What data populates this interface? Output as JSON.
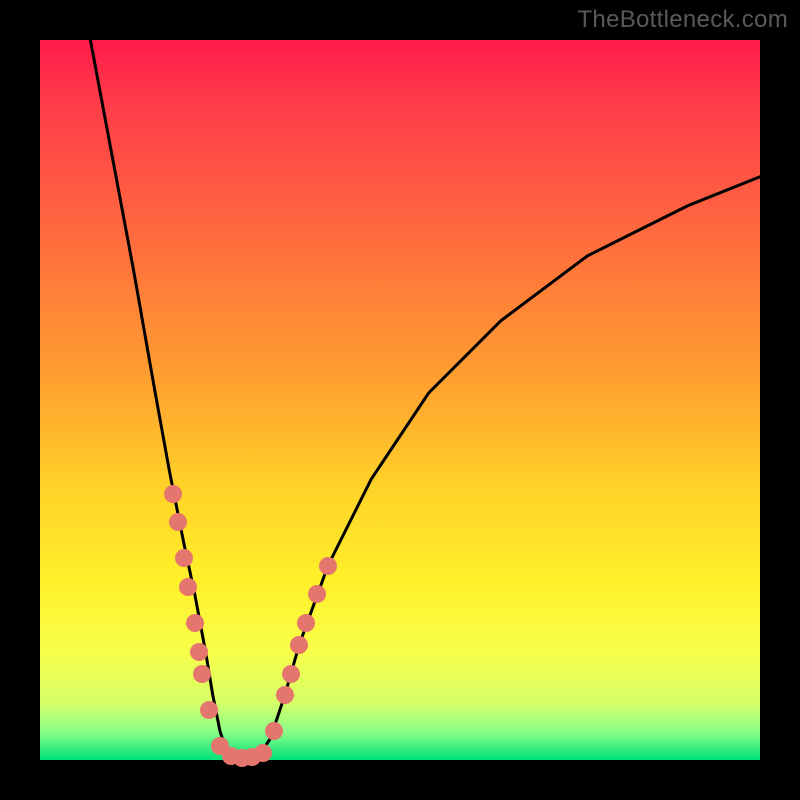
{
  "watermark": "TheBottleneck.com",
  "chart_data": {
    "type": "line",
    "title": "",
    "xlabel": "",
    "ylabel": "",
    "xlim": [
      0,
      100
    ],
    "ylim": [
      0,
      100
    ],
    "background_gradient": {
      "top": "#ff1a4a",
      "middle": "#fff02a",
      "bottom": "#00e27a"
    },
    "series": [
      {
        "name": "bottleneck-curve",
        "x": [
          7,
          10,
          13,
          16,
          18,
          20,
          21.5,
          23,
          24,
          25,
          26,
          27,
          30,
          32,
          34,
          36,
          40,
          46,
          54,
          64,
          76,
          90,
          100
        ],
        "y": [
          100,
          84,
          68,
          51,
          40,
          30,
          23,
          15,
          9,
          4,
          1,
          0,
          0,
          3,
          9,
          16,
          27,
          39,
          51,
          61,
          70,
          77,
          81
        ]
      }
    ],
    "markers": {
      "name": "highlight-dots",
      "color": "#e5766d",
      "points": [
        {
          "x": 18.5,
          "y": 37
        },
        {
          "x": 19.2,
          "y": 33
        },
        {
          "x": 20.0,
          "y": 28
        },
        {
          "x": 20.6,
          "y": 24
        },
        {
          "x": 21.5,
          "y": 19
        },
        {
          "x": 22.1,
          "y": 15
        },
        {
          "x": 22.5,
          "y": 12
        },
        {
          "x": 23.5,
          "y": 7
        },
        {
          "x": 25.0,
          "y": 2
        },
        {
          "x": 26.5,
          "y": 0.5
        },
        {
          "x": 28.0,
          "y": 0.3
        },
        {
          "x": 29.5,
          "y": 0.4
        },
        {
          "x": 31.0,
          "y": 1
        },
        {
          "x": 32.5,
          "y": 4
        },
        {
          "x": 34.0,
          "y": 9
        },
        {
          "x": 34.8,
          "y": 12
        },
        {
          "x": 36.0,
          "y": 16
        },
        {
          "x": 37.0,
          "y": 19
        },
        {
          "x": 38.5,
          "y": 23
        },
        {
          "x": 40.0,
          "y": 27
        }
      ]
    }
  }
}
